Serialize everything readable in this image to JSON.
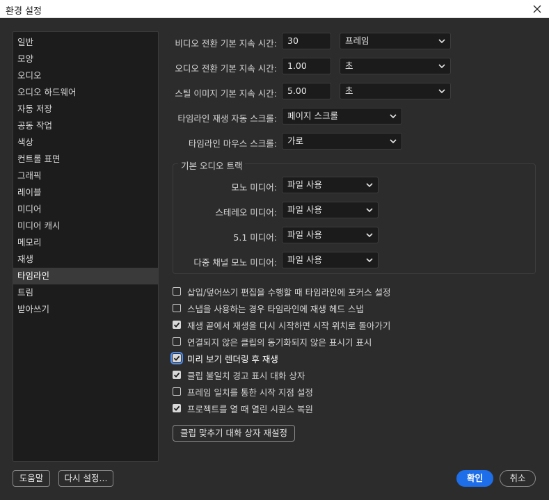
{
  "window": {
    "title": "환경 설정"
  },
  "sidebar": {
    "items": [
      {
        "label": "일반"
      },
      {
        "label": "모양"
      },
      {
        "label": "오디오"
      },
      {
        "label": "오디오 하드웨어"
      },
      {
        "label": "자동 저장"
      },
      {
        "label": "공동 작업"
      },
      {
        "label": "색상"
      },
      {
        "label": "컨트롤 표면"
      },
      {
        "label": "그래픽"
      },
      {
        "label": "레이블"
      },
      {
        "label": "미디어"
      },
      {
        "label": "미디어 캐시"
      },
      {
        "label": "메모리"
      },
      {
        "label": "재생"
      },
      {
        "label": "타임라인",
        "active": true
      },
      {
        "label": "트림"
      },
      {
        "label": "받아쓰기"
      }
    ]
  },
  "durations": {
    "video": {
      "label": "비디오 전환 기본 지속 시간:",
      "value": "30",
      "unit": "프레임"
    },
    "audio": {
      "label": "오디오 전환 기본 지속 시간:",
      "value": "1.00",
      "unit": "초"
    },
    "still": {
      "label": "스틸 이미지 기본 지속 시간:",
      "value": "5.00",
      "unit": "초"
    }
  },
  "scrolling": {
    "playback": {
      "label": "타임라인 재생 자동 스크롤:",
      "value": "페이지 스크롤"
    },
    "mouse": {
      "label": "타임라인 마우스 스크롤:",
      "value": "가로"
    }
  },
  "default_audio_tracks": {
    "title": "기본 오디오 트랙",
    "rows": [
      {
        "label": "모노 미디어:",
        "value": "파일 사용"
      },
      {
        "label": "스테레오 미디어:",
        "value": "파일 사용"
      },
      {
        "label": "5.1 미디어:",
        "value": "파일 사용"
      },
      {
        "label": "다중 채널 모노 미디어:",
        "value": "파일 사용"
      }
    ]
  },
  "checkboxes": [
    {
      "label": "삽입/덮어쓰기 편집을 수행할 때 타임라인에 포커스 설정",
      "checked": false
    },
    {
      "label": "스냅을 사용하는 경우 타임라인에 재생 헤드 스냅",
      "checked": false
    },
    {
      "label": "재생 끝에서 재생을 다시 시작하면 시작 위치로 돌아가기",
      "checked": true
    },
    {
      "label": "연결되지 않은 클립의 동기화되지 않은 표시기 표시",
      "checked": false
    },
    {
      "label": "미리 보기 렌더링 후 재생",
      "checked": true,
      "focused": true
    },
    {
      "label": "클립 불일치 경고 표시 대화 상자",
      "checked": true
    },
    {
      "label": "프레임 일치를 통한 시작 지점 설정",
      "checked": false
    },
    {
      "label": "프로젝트를 열 때 열린 시퀀스 복원",
      "checked": true
    }
  ],
  "buttons": {
    "reset_clip_fit": "클립 맞추기 대화 상자 재설정",
    "help": "도움말",
    "reset": "다시 설정...",
    "ok": "확인",
    "cancel": "취소"
  },
  "colors": {
    "accent": "#1d6ee8",
    "background": "#2c2c2c",
    "sidebar_bg": "#1c1c1c"
  },
  "icons": {
    "close": "close-icon",
    "dropdown": "chevron-down-icon",
    "check": "checkmark-icon"
  }
}
